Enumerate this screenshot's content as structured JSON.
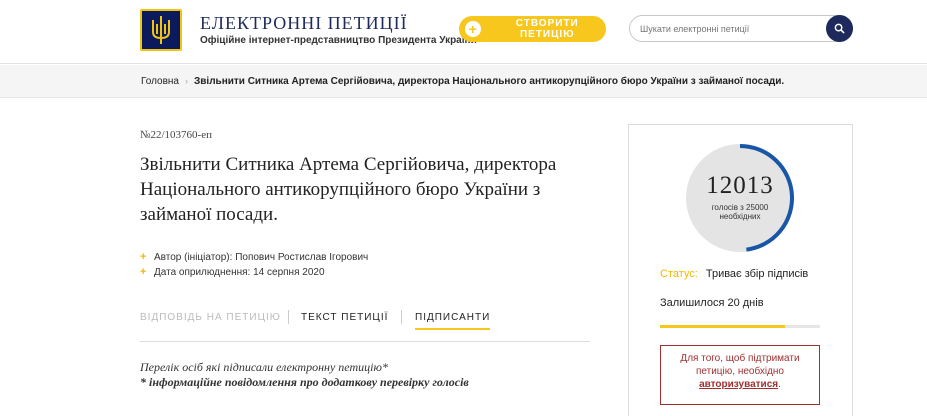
{
  "header": {
    "site_title": "ЕЛЕКТРОННІ ПЕТИЦІЇ",
    "site_subtitle": "Офіційне інтернет-представництво Президента України",
    "create_button": "СТВОРИТИ ПЕТИЦІЮ",
    "search_placeholder": "Шукати електронні петиції",
    "logo_icon": "trident-icon",
    "accent_color": "#f8c71e",
    "brand_color": "#1d2a5b"
  },
  "breadcrumb": {
    "home": "Головна",
    "separator": "›",
    "current": "Звільнити Ситника Артема Сергійовича, директора Національного антикорупційного бюро України з займаної посади."
  },
  "petition": {
    "number": "№22/103760-еп",
    "title": "Звільнити Ситника Артема Сергійовича, директора Національного антикорупційного бюро України з займаної посади.",
    "author_label": "Автор (ініціатор):",
    "author_name": "Попович Ростислав Ігорович",
    "date_label": "Дата оприлюднення:",
    "date_value": "14 серпня 2020"
  },
  "tabs": [
    {
      "label": "ВІДПОВІДЬ НА ПЕТИЦІЮ",
      "state": "disabled"
    },
    {
      "label": "ТЕКСТ ПЕТИЦІЇ",
      "state": "normal"
    },
    {
      "label": "ПІДПИСАНТИ",
      "state": "active"
    }
  ],
  "signers_info": {
    "line1": "Перелік осіб які підписали електронну петицію*",
    "line2": "* інформаційне повідомлення про додаткову перевірку голосів"
  },
  "sidebar": {
    "votes": "12013",
    "votes_needed_text": "голосів з 25000 необхідних",
    "votes_fraction": 0.4805,
    "status_label": "Статус:",
    "status_value": "Триває збір підписів",
    "remaining": "Залишилося 20 днів",
    "time_progress": 0.78,
    "auth_text_before": "Для того, щоб підтримати петицію, необхідно",
    "auth_link": "авторизуватися",
    "auth_text_after": "."
  }
}
